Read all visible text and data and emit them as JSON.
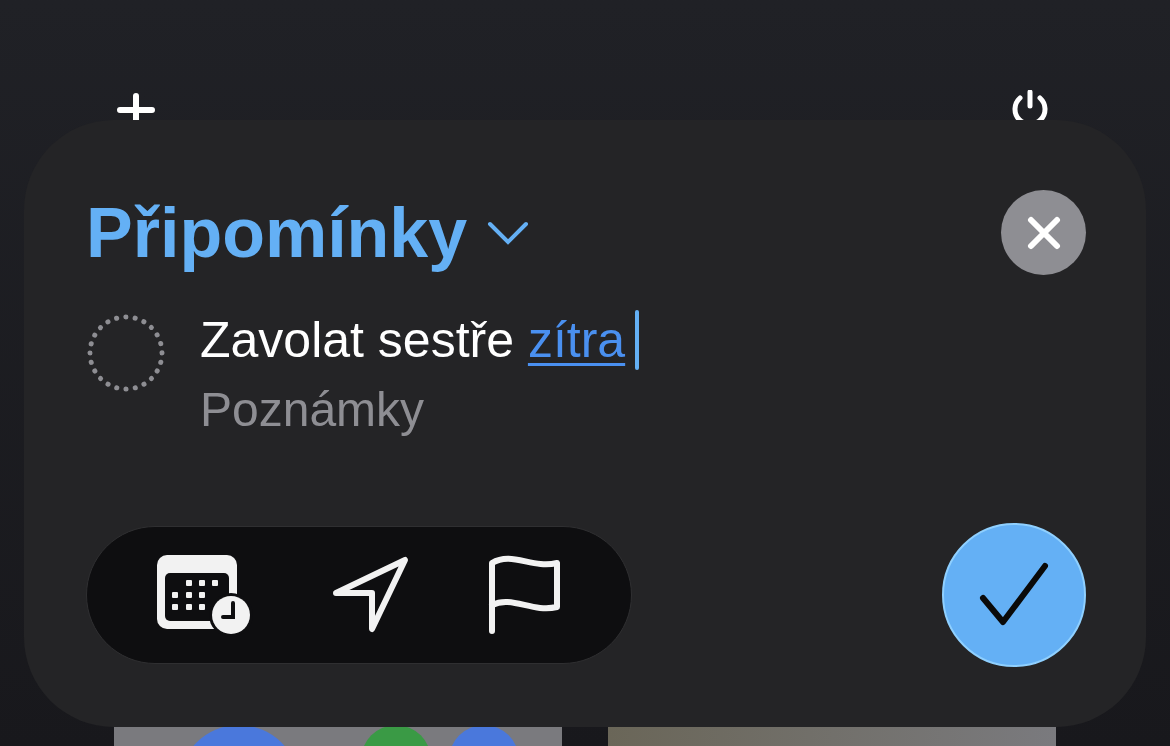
{
  "reminder_sheet": {
    "list_name": "Připomínky",
    "reminder": {
      "completed": false,
      "title": "Zavolat sestře ",
      "date_token": "zítra"
    },
    "notes": {
      "placeholder": "Poznámky"
    }
  }
}
